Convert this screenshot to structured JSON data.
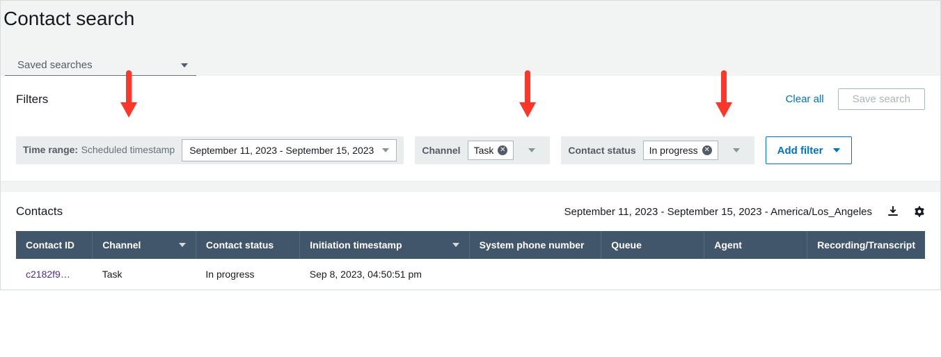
{
  "page": {
    "title": "Contact search",
    "saved_searches_label": "Saved searches"
  },
  "filters": {
    "title": "Filters",
    "clear_all_label": "Clear all",
    "save_search_label": "Save search",
    "add_filter_label": "Add filter",
    "time_range": {
      "label": "Time range:",
      "sublabel": "Scheduled timestamp",
      "value": "September 11, 2023 - September 15, 2023"
    },
    "channel": {
      "label": "Channel",
      "chip": "Task"
    },
    "contact_status": {
      "label": "Contact status",
      "chip": "In progress"
    }
  },
  "contacts": {
    "title": "Contacts",
    "meta": "September 11, 2023 - September 15, 2023 - America/Los_Angeles",
    "columns": {
      "contact_id": "Contact ID",
      "channel": "Channel",
      "contact_status": "Contact status",
      "initiation_ts": "Initiation timestamp",
      "system_phone": "System phone number",
      "queue": "Queue",
      "agent": "Agent",
      "recording": "Recording/Transcript"
    },
    "rows": [
      {
        "contact_id": "c2182f9…",
        "channel": "Task",
        "contact_status": "In progress",
        "initiation_ts": "Sep 8, 2023, 04:50:51 pm",
        "system_phone": "",
        "queue": "",
        "agent": "",
        "recording": ""
      }
    ]
  }
}
